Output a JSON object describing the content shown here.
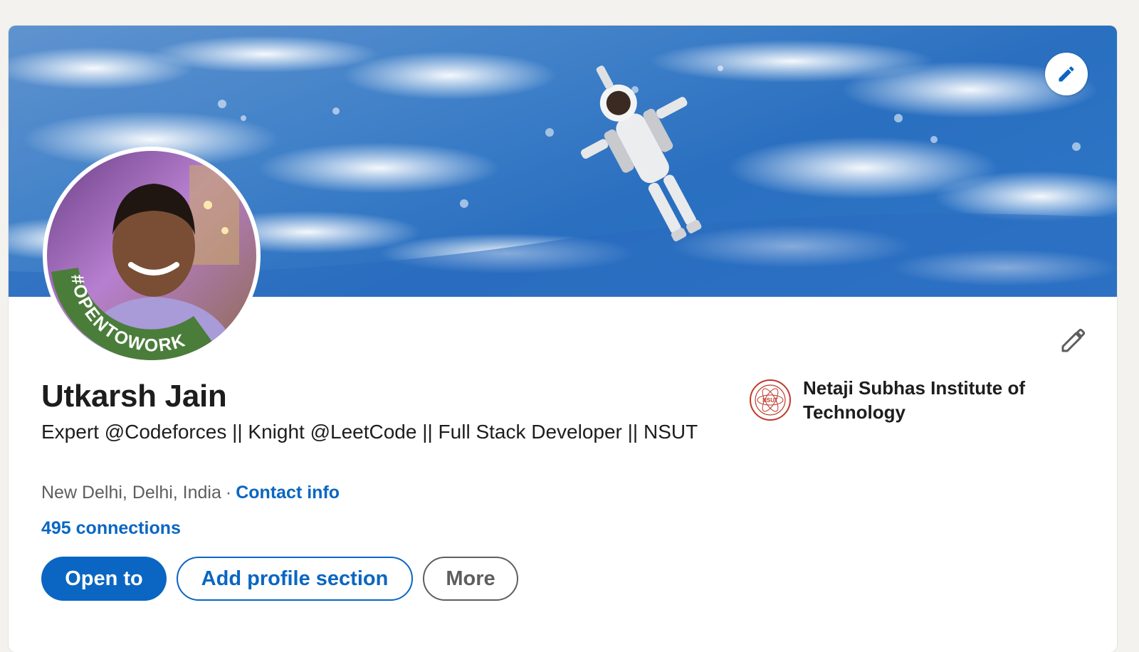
{
  "profile": {
    "name": "Utkarsh Jain",
    "headline": "Expert @Codeforces || Knight @LeetCode || Full Stack Developer || NSUT",
    "location": "New Delhi, Delhi, India",
    "separator": "·",
    "contact_info_label": "Contact info",
    "connections_label": "495 connections",
    "open_to_work_badge": "#OPENTOWORK"
  },
  "actions": {
    "open_to_label": "Open to",
    "add_section_label": "Add profile section",
    "more_label": "More"
  },
  "education": {
    "school_name": "Netaji Subhas Institute of Technology",
    "logo_text": "NSUT"
  },
  "icons": {
    "banner_edit": "pencil-icon",
    "intro_edit": "pencil-icon",
    "school_logo": "nsut-seal-icon"
  },
  "colors": {
    "brand_blue": "#0a66c2",
    "open_to_work_green": "#4a7d3a",
    "text_primary": "#1d1d1d",
    "text_secondary": "#5e5e5e",
    "page_background": "#f3f2ef"
  }
}
